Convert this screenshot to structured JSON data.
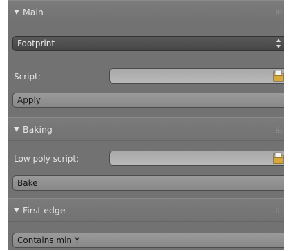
{
  "panels": {
    "main": {
      "title": "Main",
      "dropdown_value": "Footprint",
      "script_label": "Script:",
      "script_value": "",
      "apply_label": "Apply"
    },
    "baking": {
      "title": "Baking",
      "low_poly_label": "Low poly script:",
      "low_poly_value": "",
      "bake_label": "Bake"
    },
    "first_edge": {
      "title": "First edge",
      "button_label": "Contains min Y"
    }
  },
  "icons": {
    "collapse": "triangle-down-icon",
    "grip": "drag-grip-icon",
    "file_browse": "folder-icon",
    "updown": "updown-arrows-icon"
  },
  "colors": {
    "panel_bg": "#727272",
    "field_bg": "#b0b0b0",
    "dropdown_bg": "#4e4e4e",
    "button_bg": "#919191"
  }
}
